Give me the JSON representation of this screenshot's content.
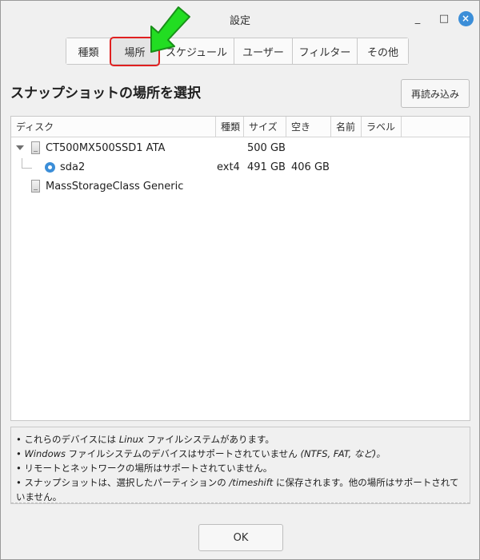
{
  "window": {
    "title": "設定",
    "minimize_label": "_",
    "maximize_label": "□",
    "close_label": "×"
  },
  "tabs": [
    {
      "label": "種類",
      "active": false
    },
    {
      "label": "場所",
      "active": true
    },
    {
      "label": "スケジュール",
      "active": false
    },
    {
      "label": "ユーザー",
      "active": false
    },
    {
      "label": "フィルター",
      "active": false
    },
    {
      "label": "その他",
      "active": false
    }
  ],
  "page": {
    "heading": "スナップショットの場所を選択",
    "reload_label": "再読み込み"
  },
  "table": {
    "columns": {
      "device": "ディスク",
      "type": "種類",
      "size": "サイズ",
      "free": "空き",
      "name": "名前",
      "label": "ラベル"
    },
    "rows": [
      {
        "device": "CT500MX500SSD1 ATA",
        "type": "",
        "size": "500 GB",
        "free": "",
        "name": "",
        "label": ""
      },
      {
        "device": "sda2",
        "type": "ext4",
        "size": "491 GB",
        "free": "406 GB",
        "name": "",
        "label": ""
      },
      {
        "device": "MassStorageClass Generic",
        "type": "",
        "size": "",
        "free": "",
        "name": "",
        "label": ""
      }
    ]
  },
  "notes": {
    "line1_pre": "• これらのデバイスには ",
    "line1_em": "Linux",
    "line1_post": " ファイルシステムがあります。",
    "line2_em1": "• Windows",
    "line2_mid": " ファイルシステムのデバイスはサポートされていません ",
    "line2_em2": "(NTFS, FAT, など)。",
    "line3": "• リモートとネットワークの場所はサポートされていません。",
    "line4_pre": "• スナップショットは、選択したパーティションの ",
    "line4_em": "/timeshift",
    "line4_post": " に保存されます。他の場所はサポートされていません。"
  },
  "footer": {
    "ok_label": "OK"
  },
  "colors": {
    "accent": "#3b8ed8",
    "highlight": "#e02020",
    "arrow": "#22dd22"
  }
}
